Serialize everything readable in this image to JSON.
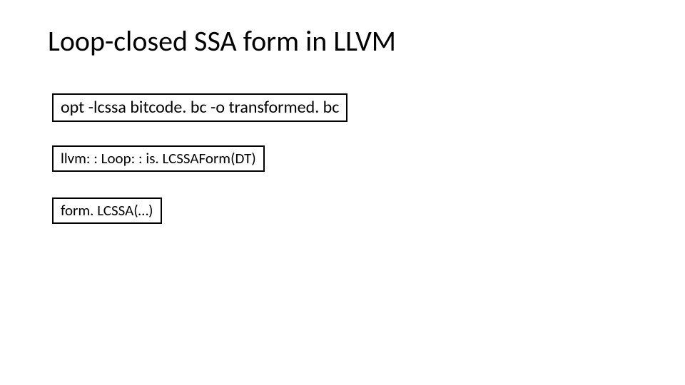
{
  "title": "Loop-closed SSA form in LLVM",
  "boxes": {
    "box1": "opt -lcssa bitcode. bc -o transformed. bc",
    "box2": "llvm: : Loop: : is. LCSSAForm(DT)",
    "box3": "form. LCSSA(…)"
  }
}
